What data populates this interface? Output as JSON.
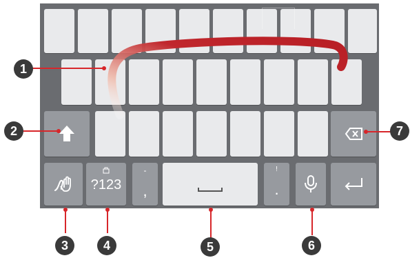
{
  "keyboard": {
    "symbols_key": {
      "label": "?123"
    },
    "comma_key": {
      "label": ",",
      "alt": "-"
    },
    "period_key": {
      "label": ".",
      "alt": "!"
    }
  },
  "callouts": {
    "c1": "1",
    "c2": "2",
    "c3": "3",
    "c4": "4",
    "c5": "5",
    "c6": "6",
    "c7": "7"
  },
  "colors": {
    "keyboard_bg": "#6a6c70",
    "letter_key": "#e9eaec",
    "function_key": "#979a9f",
    "swipe_trail": "#c0272d",
    "callout_line": "#d7262a",
    "callout_badge": "#3a3a3a"
  },
  "icons": [
    "shift-icon",
    "backspace-icon",
    "handwriting-icon",
    "spacebar-icon",
    "microphone-icon",
    "enter-icon"
  ]
}
